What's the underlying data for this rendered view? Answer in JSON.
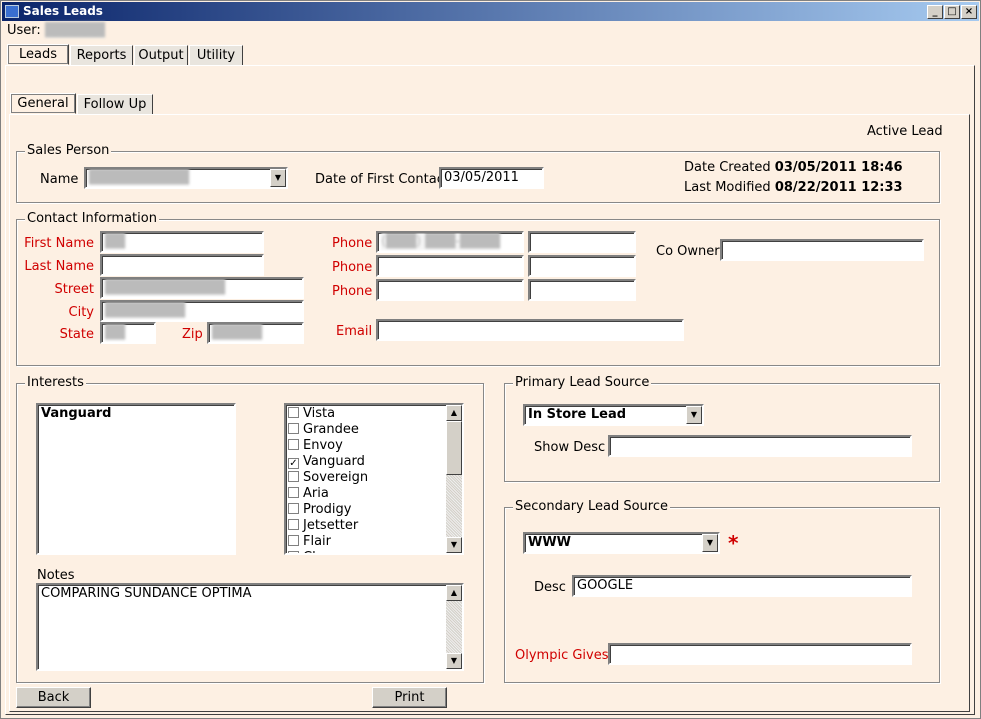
{
  "window": {
    "title": "Sales Leads"
  },
  "user": {
    "label": "User:",
    "value": "██████"
  },
  "main_tabs": [
    {
      "label": "Leads"
    },
    {
      "label": "Reports"
    },
    {
      "label": "Output"
    },
    {
      "label": "Utility"
    }
  ],
  "sub_tabs": [
    {
      "label": "General"
    },
    {
      "label": "Follow Up"
    }
  ],
  "status": "Active Lead",
  "sales_person": {
    "legend": "Sales Person",
    "name_label": "Name",
    "name_value": "██████████",
    "date_first_contact_label": "Date of First Contact",
    "date_first_contact_value": "03/05/2011",
    "date_created_label": "Date Created",
    "date_created_value": "03/05/2011 18:46",
    "last_modified_label": "Last Modified",
    "last_modified_value": "08/22/2011 12:33"
  },
  "contact": {
    "legend": "Contact Information",
    "first_name_label": "First Name",
    "first_name_value": "██",
    "last_name_label": "Last Name",
    "last_name_value": "",
    "street_label": "Street",
    "street_value": "████████████",
    "city_label": "City",
    "city_value": "████████",
    "state_label": "State",
    "state_value": "██",
    "zip_label": "Zip",
    "zip_value": "█████",
    "phone_label": "Phone",
    "phone1_value": "(███) ███-████",
    "email_label": "Email",
    "email_value": "",
    "co_owner_label": "Co Owner",
    "co_owner_value": ""
  },
  "interests": {
    "legend": "Interests",
    "selected": "Vanguard",
    "options": [
      {
        "label": "Vista",
        "checked": false
      },
      {
        "label": "Grandee",
        "checked": false
      },
      {
        "label": "Envoy",
        "checked": false
      },
      {
        "label": "Vanguard",
        "checked": true
      },
      {
        "label": "Sovereign",
        "checked": false
      },
      {
        "label": "Aria",
        "checked": false
      },
      {
        "label": "Prodigy",
        "checked": false
      },
      {
        "label": "Jetsetter",
        "checked": false
      },
      {
        "label": "Flair",
        "checked": false
      },
      {
        "label": "Cl...",
        "checked": false
      }
    ]
  },
  "notes": {
    "label": "Notes",
    "value": "COMPARING SUNDANCE OPTIMA"
  },
  "primary_source": {
    "legend": "Primary Lead Source",
    "value": "In Store Lead",
    "show_desc_label": "Show Desc",
    "show_desc_value": ""
  },
  "secondary_source": {
    "legend": "Secondary Lead Source",
    "value": "WWW",
    "required_mark": "*",
    "desc_label": "Desc",
    "desc_value": "GOOGLE",
    "olympic_label": "Olympic Gives",
    "olympic_value": ""
  },
  "buttons": {
    "back": "Back",
    "print": "Print"
  },
  "colors": {
    "required": "#d00000",
    "background": "#fdf0e3"
  }
}
